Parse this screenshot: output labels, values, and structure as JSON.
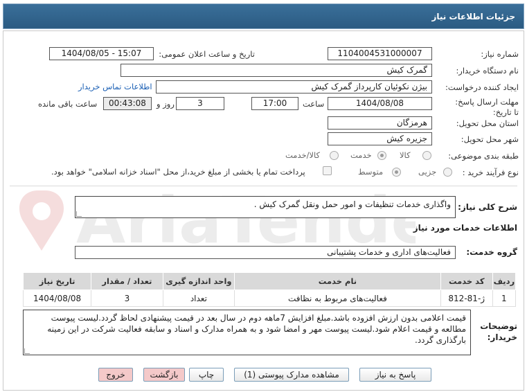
{
  "header": {
    "title": "جزئیات اطلاعات نیاز"
  },
  "form": {
    "need_number_label": "شماره نیاز:",
    "need_number": "1104004531000007",
    "announce_label": "تاریخ و ساعت اعلان عمومی:",
    "announce_value": "1404/08/05 - 15:07",
    "buyer_org_label": "نام دستگاه خریدار:",
    "buyer_org": "گمرک کیش",
    "creator_label": "ایجاد کننده درخواست:",
    "creator": "بیژن نکوئیان کارپرداز گمرک کیش",
    "contact_link": "اطلاعات تماس خریدار",
    "deadline_label": "مهلت ارسال پاسخ: تا تاریخ:",
    "deadline_date": "1404/08/08",
    "time_label": "ساعت",
    "deadline_time": "17:00",
    "days_value": "3",
    "days_label": "روز و",
    "remaining_time": "00:43:08",
    "remaining_label": "ساعت باقی مانده",
    "province_label": "استان محل تحویل:",
    "province": "هرمزگان",
    "city_label": "شهر محل تحویل:",
    "city": "جزیره کیش",
    "category_label": "طبقه بندی موضوعی:",
    "category_options": [
      "کالا",
      "خدمت",
      "کالا/خدمت"
    ],
    "purchase_type_label": "نوع فرآیند خرید :",
    "purchase_options": [
      "جزیی",
      "متوسط"
    ],
    "purchase_note": "پرداخت تمام یا بخشی از مبلغ خرید،از محل \"اسناد خزانه اسلامی\" خواهد بود."
  },
  "summary": {
    "label": "شرح کلی نیاز:",
    "text": "واگذاری خدمات تنظیفات و امور حمل ونقل گمرک کیش ."
  },
  "services_section": {
    "title": "اطلاعات خدمات مورد نیاز",
    "group_label": "گروه خدمت:",
    "group_value": "فعالیت‌های اداری و خدمات پشتیبانی"
  },
  "table": {
    "headers": [
      "ردیف",
      "کد خدمت",
      "نام خدمت",
      "واحد اندازه گیری",
      "تعداد / مقدار",
      "تاریخ نیاز"
    ],
    "rows": [
      [
        "1",
        "ژ-81-812",
        "فعالیت‌های مربوط به نظافت",
        "تعداد",
        "3",
        "1404/08/08"
      ]
    ]
  },
  "notes": {
    "label": "توضیحات خریدار:",
    "text": "قیمت اعلامی بدون ارزش افزوده باشد.مبلغ افزایش 7ماهه دوم در سال بعد در قیمت پیشنهادی لحاظ گردد.لیست پیوست مطالعه و قیمت اعلام شود.لیست پیوست مهر و امضا شود و به همراه مدارک و اسناد و سابقه فعالیت شرکت در این زمینه بارگذاری گردد."
  },
  "buttons": {
    "reply": "پاسخ به نیاز",
    "attachments": "مشاهده مدارک پیوستی (1)",
    "print": "چاپ",
    "back": "بازگشت",
    "exit": "خروج"
  },
  "watermark": {
    "text": "AriaTender.net"
  },
  "colors": {
    "header_bg": "#2b5b82",
    "back_button_bg": "#f4c9c9",
    "exit_button_bg": "#f4c9c9"
  }
}
